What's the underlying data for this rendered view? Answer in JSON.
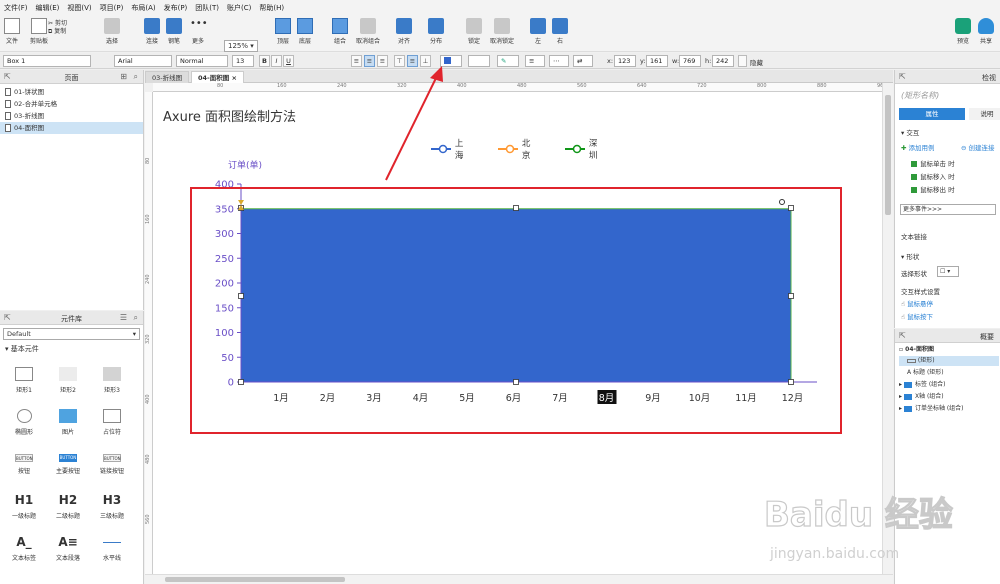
{
  "menubar": [
    "文件(F)",
    "编辑(E)",
    "视图(V)",
    "项目(P)",
    "布局(A)",
    "发布(P)",
    "团队(T)",
    "账户(C)",
    "帮助(H)"
  ],
  "toolbar": {
    "file": "文件",
    "clipboard": "剪贴板",
    "cut": "剪切",
    "copy": "复制",
    "paste": "粘贴",
    "select": "选择",
    "connect": "连接",
    "pen": "钢笔",
    "more": "更多",
    "zoom_value": "125%",
    "zoom_label": "缩放",
    "top": "顶层",
    "bottom": "底层",
    "group": "组合",
    "ungroup": "取消组合",
    "align": "对齐",
    "distribute": "分布",
    "lock": "锁定",
    "unlock": "取消锁定",
    "left": "左",
    "right": "右",
    "preview": "预览",
    "share": "共享"
  },
  "formatbar": {
    "widget_name": "Box 1",
    "font": "Arial",
    "weight": "Normal",
    "size": "13",
    "x_label": "x:",
    "x": "123",
    "y_label": "y:",
    "y": "161",
    "w_label": "w:",
    "w": "769",
    "h_label": "h:",
    "h": "242",
    "hide": "隐藏"
  },
  "pages": {
    "title": "页面",
    "items": [
      {
        "label": "01-饼状图",
        "selected": false
      },
      {
        "label": "02-合并单元格",
        "selected": false
      },
      {
        "label": "03-折线图",
        "selected": false
      },
      {
        "label": "04-面积图",
        "selected": true
      }
    ]
  },
  "library": {
    "title": "元件库",
    "selected": "Default",
    "section": "基本元件",
    "widgets": [
      {
        "label": "矩形1",
        "icon": "rect-icon"
      },
      {
        "label": "矩形2",
        "icon": "rect2-icon"
      },
      {
        "label": "矩形3",
        "icon": "rect3-icon"
      },
      {
        "label": "椭圆形",
        "icon": "ellipse-icon"
      },
      {
        "label": "图片",
        "icon": "image-icon"
      },
      {
        "label": "占位符",
        "icon": "placeholder-icon"
      },
      {
        "label": "按钮",
        "icon": "button-icon",
        "text": "BUTTON"
      },
      {
        "label": "主要按钮",
        "icon": "primary-button-icon",
        "text": "BUTTON"
      },
      {
        "label": "链接按钮",
        "icon": "link-button-icon",
        "text": "BUTTON"
      },
      {
        "label": "一级标题",
        "icon": "h1-icon",
        "text": "H1"
      },
      {
        "label": "二级标题",
        "icon": "h2-icon",
        "text": "H2"
      },
      {
        "label": "三级标题",
        "icon": "h3-icon",
        "text": "H3"
      },
      {
        "label": "文本标签",
        "icon": "text-label-icon",
        "text": "A_"
      },
      {
        "label": "文本段落",
        "icon": "text-paragraph-icon",
        "text": "A≡"
      },
      {
        "label": "水平线",
        "icon": "horizontal-line-icon"
      }
    ]
  },
  "tabs": [
    {
      "label": "03-折线图",
      "active": false
    },
    {
      "label": "04-面积图",
      "active": true
    }
  ],
  "rulers": {
    "top": [
      "80",
      "160",
      "240",
      "320",
      "400",
      "480",
      "560",
      "640",
      "720",
      "800",
      "880",
      "960"
    ],
    "left": [
      "80",
      "160",
      "240",
      "320",
      "400",
      "480",
      "560",
      "640"
    ]
  },
  "canvas_title": "Axure 面积图绘制方法",
  "chart_data": {
    "type": "area",
    "title": "",
    "ylabel": "订单(单)",
    "xlabel": "",
    "categories": [
      "1月",
      "2月",
      "3月",
      "4月",
      "5月",
      "6月",
      "7月",
      "8月",
      "9月",
      "10月",
      "11月",
      "12月"
    ],
    "ylim": [
      0,
      400
    ],
    "yticks": [
      "0",
      "50",
      "100",
      "150",
      "200",
      "250",
      "300",
      "350",
      "400"
    ],
    "highlighted_category": "8月",
    "legend": [
      "上海",
      "北京",
      "深圳"
    ],
    "legend_colors": [
      "#3366cc",
      "#ff9933",
      "#109618"
    ],
    "series": [
      {
        "name": "上海",
        "color": "#3366cc",
        "values": [
          350,
          350,
          350,
          350,
          350,
          350,
          350,
          350,
          350,
          350,
          350,
          350
        ]
      }
    ],
    "grid": false,
    "legend_position": "top"
  },
  "inspector": {
    "title": "检视",
    "name_placeholder": "(矩形名称)",
    "tab_props": "属性",
    "tab_notes": "说明",
    "interaction": "交互",
    "add_case": "添加用例",
    "create_link": "创建连接",
    "events": [
      "鼠标单击 时",
      "鼠标移入 时",
      "鼠标移出 时"
    ],
    "more_events": "更多事件>>>",
    "text_link": "文本链接",
    "shape": "形状",
    "select_shape": "选择形状",
    "interaction_style": "交互样式设置",
    "hover": "鼠标悬停",
    "mouse_down": "鼠标按下"
  },
  "outline": {
    "title": "概要",
    "page": "04-面积图",
    "items": [
      {
        "label": "(矩形)",
        "type": "rect",
        "selected": true
      },
      {
        "label": "标题 (矩形)",
        "type": "text",
        "selected": false
      },
      {
        "label": "标签 (组合)",
        "type": "folder",
        "selected": false
      },
      {
        "label": "X轴 (组合)",
        "type": "folder",
        "selected": false
      },
      {
        "label": "订单坐标轴 (组合)",
        "type": "folder",
        "selected": false
      }
    ]
  },
  "watermark": {
    "brand": "Baidu 经验",
    "url": "jingyan.baidu.com"
  },
  "colors": {
    "accent": "#3a7bc8",
    "selection": "#e0242c",
    "area_fill": "#3366cc",
    "axis_text": "#6a4fc7"
  }
}
